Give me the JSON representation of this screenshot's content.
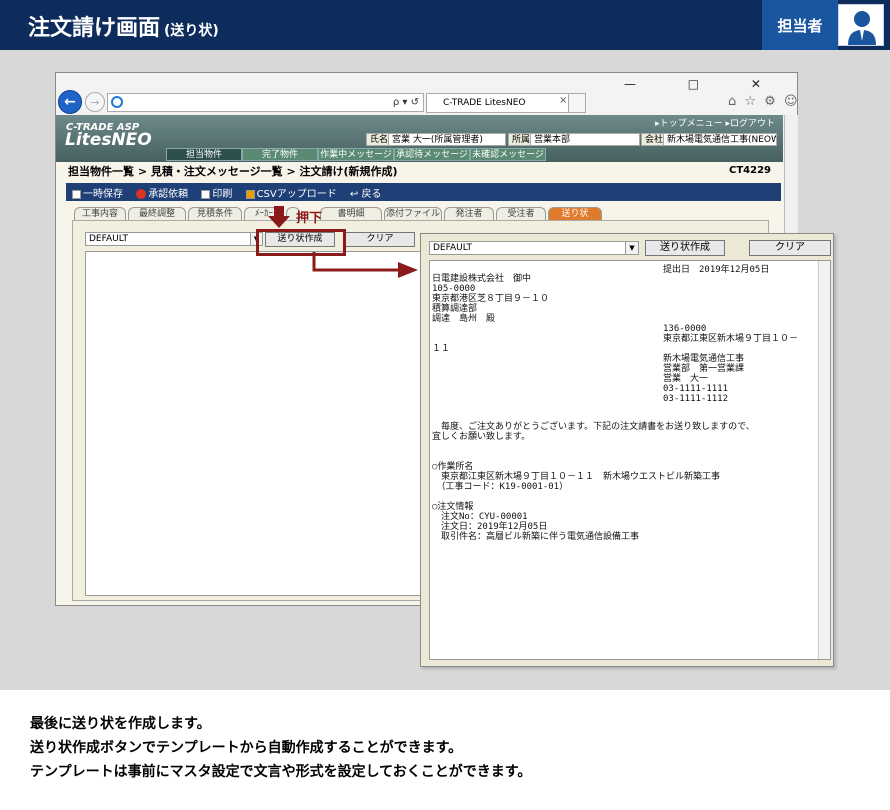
{
  "header": {
    "title": "注文請け画面",
    "subtitle": "(送り状)",
    "role": "担当者",
    "avatar_icon": "person-icon"
  },
  "browser": {
    "window_controls": "— □ ✕",
    "address": "ρ ▾ ↺",
    "tab_title": "C-TRADE LitesNEO",
    "tab_close": "×",
    "tool_icons": "⌂ ☆ ⚙ ☺"
  },
  "app": {
    "logo_small": "C-TRADE ASP",
    "logo_big": "LitesNEO",
    "top_links": "▸トップメニュー ▸ログアウト",
    "user": {
      "name_label": "氏名",
      "name_value": "宮業 大一(所属管理者)",
      "dept_label": "所属",
      "dept_value": "営業本部",
      "company_label": "会社",
      "company_value": "新木場電気通信工事(NEOW/"
    },
    "nav_tabs": [
      "担当物件",
      "完了物件",
      "作業中メッセージ",
      "承認待メッセージ",
      "未確認メッセージ"
    ],
    "breadcrumb": "担当物件一覧 > 見積・注文メッセージ一覧 > 注文請け(新規作成)",
    "page_code": "CT4229",
    "toolbar": {
      "save": "一時保存",
      "approve": "承認依頼",
      "print": "印刷",
      "csv": "CSVアップロード",
      "back": "戻る"
    },
    "form_tabs": [
      "工事内容",
      "最終調整",
      "見積条件",
      "ﾒｰｶｰ",
      "",
      "書明細",
      "添付ファイル",
      "発注者",
      "受注者",
      "送り状"
    ],
    "template_value": "DEFAULT",
    "create_btn": "送り状作成",
    "clear_btn": "クリア"
  },
  "callout": {
    "label": "押下"
  },
  "popup": {
    "template_value": "DEFAULT",
    "create_btn": "送り状作成",
    "clear_btn": "クリア",
    "letter": [
      "提出日　2019年12月05日",
      "日電建設株式会社　御中",
      "105-0000",
      "東京都港区芝８丁目９－１０",
      "積算調達部",
      "調達　島州　殿",
      "136-0000",
      "東京都江東区新木場９丁目１０－",
      "１１",
      "新木場電気通信工事",
      "営業部　第一営業課",
      "営業　大一",
      "03-1111-1111",
      "03-1111-1112",
      "　毎度、ご注文ありがとうございます。下記の注文請書をお送り致しますので、",
      "宜しくお願い致します。",
      "○作業所名",
      "　東京都江東区新木場９丁目１０－１１　新木場ウエストビル新築工事",
      "　（工事コード：K19-0001-01）",
      "○注文情報",
      "　注文No：CYU-00001",
      "　注文日：2019年12月05日",
      "　取引件名：高層ビル新築に伴う電気通信設備工事"
    ]
  },
  "description": [
    "最後に送り状を作成します。",
    "送り状作成ボタンでテンプレートから自動作成することができます。",
    "テンプレートは事前にマスタ設定で文言や形式を設定しておくことができます。"
  ]
}
